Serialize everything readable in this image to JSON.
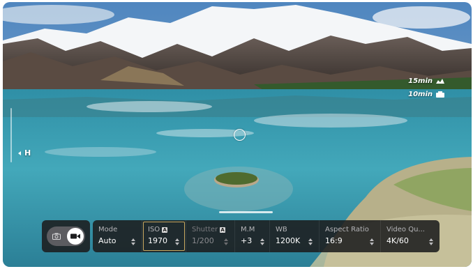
{
  "overlay": {
    "battery_1": {
      "time": "15min",
      "icon": "camera-battery-icon"
    },
    "battery_2": {
      "time": "10min",
      "icon": "controller-battery-icon"
    },
    "gimbal_label": "H"
  },
  "capture": {
    "photo_icon": "camera-icon",
    "video_icon": "video-camera-icon",
    "selected": "video"
  },
  "params": [
    {
      "id": "mode",
      "label": "Mode",
      "value": "Auto",
      "auto_badge": false,
      "dim": false,
      "selected": false
    },
    {
      "id": "iso",
      "label": "ISO",
      "value": "1970",
      "auto_badge": true,
      "dim": false,
      "selected": true
    },
    {
      "id": "shutter",
      "label": "Shutter",
      "value": "1/200",
      "auto_badge": true,
      "dim": true,
      "selected": false
    },
    {
      "id": "mm",
      "label": "M.M",
      "value": "+3",
      "auto_badge": false,
      "dim": false,
      "selected": false
    },
    {
      "id": "wb",
      "label": "WB",
      "value": "1200K",
      "auto_badge": false,
      "dim": false,
      "selected": false
    },
    {
      "id": "aspect",
      "label": "Aspect Ratio",
      "value": "16:9",
      "auto_badge": false,
      "dim": false,
      "selected": false
    },
    {
      "id": "video_quality",
      "label": "Video Qu...",
      "value": "4K/60",
      "auto_badge": false,
      "dim": false,
      "selected": false
    }
  ],
  "auto_badge_text": "A",
  "colors": {
    "panel_bg": "#1c1c1e",
    "selection_border": "#c8a860",
    "lake": "#3aa0b8",
    "sky": "#6c9cc8"
  }
}
